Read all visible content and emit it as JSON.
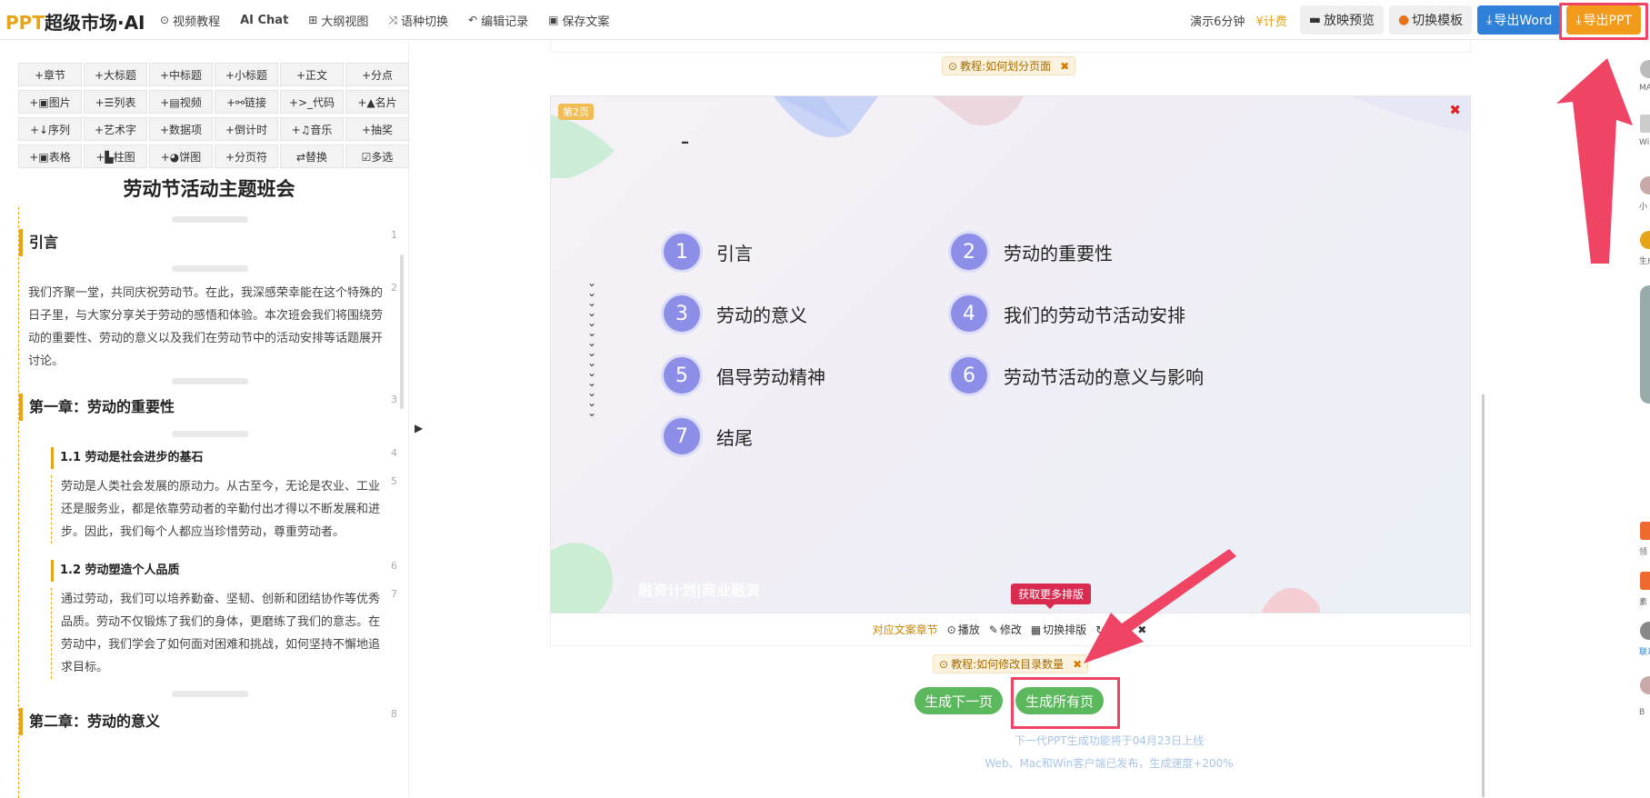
{
  "header": {
    "logo_prefix": "PPT",
    "logo_main": "超级市场·AI",
    "nav": [
      {
        "icon": "play-circle-icon",
        "glyph": "⊙",
        "label": "视频教程"
      },
      {
        "icon": "ai-icon",
        "glyph": "",
        "label": "AI Chat"
      },
      {
        "icon": "outline-icon",
        "glyph": "⊞",
        "label": "大纲视图"
      },
      {
        "icon": "shuffle-icon",
        "glyph": "⤨",
        "label": "语种切换"
      },
      {
        "icon": "undo-icon",
        "glyph": "↶",
        "label": "编辑记录"
      },
      {
        "icon": "save-icon",
        "glyph": "▣",
        "label": "保存文案"
      }
    ],
    "demo_time": "演示6分钟",
    "fee": "¥计费",
    "preview_label": "放映预览",
    "template_label": "切换模板",
    "export_word_label": "导出Word",
    "export_ppt_label": "导出PPT"
  },
  "toolbar": {
    "tools": [
      "+章节",
      "+大标题",
      "+中标题",
      "+小标题",
      "+正文",
      "+分点",
      "+▣图片",
      "+☰列表",
      "+▤视频",
      "+⚯链接",
      "+>_代码",
      "+▲名片",
      "+↓序列",
      "+艺术字",
      "+数据项",
      "+倒计时",
      "+♫音乐",
      "+抽奖",
      "+▣表格",
      "+▙柱图",
      "+◕饼图",
      "+分页符",
      "⇄替换",
      "☑多选"
    ]
  },
  "document": {
    "title": "劳动节活动主题班会",
    "sections": [
      {
        "type": "chapter",
        "num": "1",
        "text": "引言"
      },
      {
        "type": "para",
        "num": "2",
        "text": "我们齐聚一堂，共同庆祝劳动节。在此，我深感荣幸能在这个特殊的日子里，与大家分享关于劳动的感悟和体验。本次班会我们将围绕劳动的重要性、劳动的意义以及我们在劳动节中的活动安排等话题展开讨论。"
      },
      {
        "type": "chapter",
        "num": "3",
        "text": "第一章：劳动的重要性"
      },
      {
        "type": "sub",
        "num": "4",
        "text": "1.1 劳动是社会进步的基石"
      },
      {
        "type": "subpara",
        "num": "5",
        "text": "劳动是人类社会发展的原动力。从古至今，无论是农业、工业还是服务业，都是依靠劳动者的辛勤付出才得以不断发展和进步。因此，我们每个人都应当珍惜劳动，尊重劳动者。"
      },
      {
        "type": "sub",
        "num": "6",
        "text": "1.2 劳动塑造个人品质"
      },
      {
        "type": "subpara",
        "num": "7",
        "text": "通过劳动，我们可以培养勤奋、坚韧、创新和团结协作等优秀品质。劳动不仅锻炼了我们的身体，更磨练了我们的意志。在劳动中，我们学会了如何面对困难和挑战，如何坚持不懈地追求目标。"
      },
      {
        "type": "chapter",
        "num": "8",
        "text": "第二章：劳动的意义"
      }
    ]
  },
  "slide": {
    "tutorial_top": "教程:如何划分页面",
    "page_badge": "第2页",
    "dash": "–",
    "chevrons": "vvvvvvvvvvvvvv",
    "toc": [
      {
        "n": "1",
        "label": "引言"
      },
      {
        "n": "2",
        "label": "劳动的重要性"
      },
      {
        "n": "3",
        "label": "劳动的意义"
      },
      {
        "n": "4",
        "label": "我们的劳动节活动安排"
      },
      {
        "n": "5",
        "label": "倡导劳动精神"
      },
      {
        "n": "6",
        "label": "劳动节活动的意义与影响"
      },
      {
        "n": "7",
        "label": "结尾"
      }
    ],
    "watermark": "融资计划|商业融资",
    "more_layouts": "获取更多排版",
    "actions": [
      {
        "icon": "",
        "label": "对应文案章节"
      },
      {
        "icon": "⊙",
        "label": "播放"
      },
      {
        "icon": "✎",
        "label": "修改"
      },
      {
        "icon": "▦",
        "label": "切换排版"
      },
      {
        "icon": "↻",
        "label": "刷新"
      },
      {
        "icon": "✖",
        "label": ""
      }
    ],
    "tutorial_bottom": "教程:如何修改目录数量",
    "gen_next": "生成下一页",
    "gen_all": "生成所有页",
    "note1": "下一代PPT生成功能将于04月23日上线",
    "note2": "Web、Mac和Win客户端已发布，生成速度+200%"
  },
  "rail": {
    "items": [
      "MA",
      "Wi",
      "小",
      "生成",
      "领",
      "素",
      "联系",
      "B"
    ]
  },
  "colors": {
    "accent": "#e8a317",
    "blue": "#2e80d8",
    "green": "#5cb85c",
    "highlight": "#ef4463",
    "circle": "#8c8ee8"
  }
}
